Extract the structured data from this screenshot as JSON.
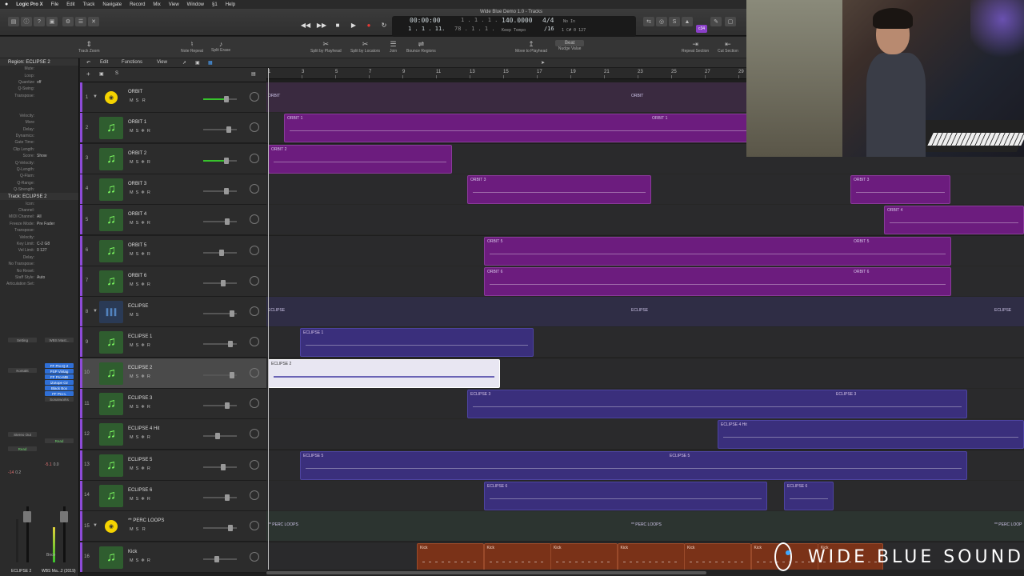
{
  "menubar": {
    "app": "Logic Pro X",
    "items": [
      "File",
      "Edit",
      "Track",
      "Navigate",
      "Record",
      "Mix",
      "View",
      "Window",
      "§1",
      "Help"
    ]
  },
  "window_title": "Wide Blue Demo 1.0 - Tracks",
  "lcd": {
    "time": "00:00:00",
    "bars": "1 . 1 . 1 .",
    "beat_sub": "1",
    "bars2": "1 . 1 . 1 .",
    "beat2": "78 . 1 . 1 .",
    "tempo": "140.0000",
    "tempo_label": "Keep Tempo",
    "sig": "4/4",
    "div": "/16",
    "in": "No In",
    "out": "1 C# 0 127",
    "cpu": "cpu"
  },
  "control_badge": "c34",
  "toolbar": {
    "tools": [
      "Track Zoom",
      "Note Repeat",
      "Split Erase",
      "Split by Playhead",
      "Split by Locators",
      "Join",
      "Bounce Regions",
      "Move to Playhead",
      "Nudge Value",
      "Repeat Section",
      "Cut Section"
    ],
    "nudge": "Beat"
  },
  "tracklist_bar": {
    "edit": "Edit",
    "functions": "Functions",
    "view": "View"
  },
  "ruler": [
    "1",
    "3",
    "5",
    "7",
    "9",
    "11",
    "13",
    "15",
    "17",
    "19",
    "21",
    "23",
    "25",
    "27",
    "29"
  ],
  "inspector": {
    "region_header": "Region: ECLIPSE 2",
    "region_params": [
      {
        "k": "Mute:",
        "v": ""
      },
      {
        "k": "Loop:",
        "v": ""
      },
      {
        "k": "Quantize",
        "v": "off"
      },
      {
        "k": "Q-Swing:",
        "v": ""
      },
      {
        "k": "Transpose:",
        "v": ""
      },
      {
        "k": "",
        "v": ""
      },
      {
        "k": "",
        "v": ""
      },
      {
        "k": "Velocity:",
        "v": ""
      },
      {
        "k": "More",
        "v": ""
      },
      {
        "k": "Delay:",
        "v": ""
      },
      {
        "k": "Dynamics:",
        "v": ""
      },
      {
        "k": "Gate Time:",
        "v": ""
      },
      {
        "k": "Clip Length:",
        "v": ""
      },
      {
        "k": "Score:",
        "v": "Show"
      },
      {
        "k": "Q-Velocity:",
        "v": ""
      },
      {
        "k": "Q-Length:",
        "v": ""
      },
      {
        "k": "Q-Flam:",
        "v": ""
      },
      {
        "k": "Q-Range:",
        "v": ""
      },
      {
        "k": "Q-Strength:",
        "v": ""
      }
    ],
    "track_header": "Track: ECLIPSE 2",
    "track_params": [
      {
        "k": "Icon:",
        "v": ""
      },
      {
        "k": "Channel:",
        "v": ""
      },
      {
        "k": "MIDI Channel:",
        "v": "All"
      },
      {
        "k": "Freeze Mode:",
        "v": "Pre Fader"
      },
      {
        "k": "Transpose:",
        "v": ""
      },
      {
        "k": "Velocity:",
        "v": ""
      },
      {
        "k": "Key Limit:",
        "v": "C-2 G8"
      },
      {
        "k": "Vel Limit:",
        "v": "0 127"
      },
      {
        "k": "Delay:",
        "v": ""
      },
      {
        "k": "No Transpose:",
        "v": ""
      },
      {
        "k": "No Reset:",
        "v": ""
      },
      {
        "k": "Staff Style:",
        "v": "Auto"
      },
      {
        "k": "Articulation Set:",
        "v": ""
      }
    ],
    "strip_left": {
      "setting": "Setting",
      "instrument": "Kontakt",
      "output": "Stereo Out",
      "read": "Read",
      "value": "-14",
      "peak": "0.2",
      "name": "ECLIPSE 2"
    },
    "strip_right": {
      "plugins": [
        "FF Pro-Q 2",
        "PSP Vintag",
        "FF Pro-MB",
        "iZotope Oz",
        "Black Box",
        "FF Pro-L",
        "Sonarworks"
      ],
      "setting": "WBS Mast...",
      "read": "Read",
      "value": "-5.1",
      "peak": "0.0",
      "output": "Bnce",
      "name": "WBS Ma...2 (2019)"
    }
  },
  "tracks": [
    {
      "num": "1",
      "name": "ORBIT",
      "type": "folder",
      "vol": 0.7,
      "fill": true
    },
    {
      "num": "2",
      "name": "ORBIT 1",
      "type": "midi",
      "vol": 0.75
    },
    {
      "num": "3",
      "name": "ORBIT 2",
      "type": "midi",
      "vol": 0.7,
      "fill": true
    },
    {
      "num": "4",
      "name": "ORBIT 3",
      "type": "midi",
      "vol": 0.7
    },
    {
      "num": "5",
      "name": "ORBIT 4",
      "type": "midi",
      "vol": 0.72
    },
    {
      "num": "6",
      "name": "ORBIT 5",
      "type": "midi",
      "vol": 0.55
    },
    {
      "num": "7",
      "name": "ORBIT 6",
      "type": "midi",
      "vol": 0.6
    },
    {
      "num": "8",
      "name": "ECLIPSE",
      "type": "audio",
      "vol": 0.85
    },
    {
      "num": "9",
      "name": "ECLIPSE 1",
      "type": "midi",
      "vol": 0.8
    },
    {
      "num": "10",
      "name": "ECLIPSE 2",
      "type": "midi",
      "vol": 0.85,
      "selected": true
    },
    {
      "num": "11",
      "name": "ECLIPSE 3",
      "type": "midi",
      "vol": 0.72
    },
    {
      "num": "12",
      "name": "ECLIPSE 4 Hit",
      "type": "midi",
      "vol": 0.42
    },
    {
      "num": "13",
      "name": "ECLIPSE 5",
      "type": "midi",
      "vol": 0.6
    },
    {
      "num": "14",
      "name": "ECLIPSE 6",
      "type": "midi",
      "vol": 0.72
    },
    {
      "num": "15",
      "name": "** PERC LOOPS",
      "type": "folder",
      "vol": 0.8
    },
    {
      "num": "16",
      "name": "Kick",
      "type": "midi",
      "vol": 0.4
    }
  ],
  "regions": {
    "orbit_folder": [
      "ORBIT",
      "ORBIT"
    ],
    "orbit1": [
      "ORBIT 1",
      "ORBIT 1"
    ],
    "orbit2": "ORBIT 2",
    "orbit3": [
      "ORBIT 3",
      "ORBIT 3"
    ],
    "orbit4": "ORBIT 4",
    "orbit5": [
      "ORBIT 5",
      "ORBIT 5"
    ],
    "orbit6": [
      "ORBIT 6",
      "ORBIT 6"
    ],
    "eclipse_folder": [
      "ECLIPSE",
      "ECLIPSE",
      "ECLIPSE"
    ],
    "eclipse1": "ECLIPSE 1",
    "eclipse2": "ECLIPSE 2",
    "eclipse3": [
      "ECLIPSE 3",
      "ECLIPSE 3"
    ],
    "eclipse4": "ECLIPSE 4 Hit",
    "eclipse5": [
      "ECLIPSE 5",
      "ECLIPSE 5"
    ],
    "eclipse6": [
      "ECLIPSE 6",
      "ECLIPSE 6"
    ],
    "perc_folder": [
      "** PERC LOOPS",
      "** PERC LOOPS",
      "** PERC LOOP"
    ],
    "kick": [
      "Kick",
      "Kick",
      "Kick",
      "Kick",
      "Kick",
      "Kick",
      "Kick"
    ]
  },
  "logo_text": "WIDE BLUE SOUND",
  "colors": {
    "orbit": "#6c1c7e",
    "eclipse": "#3a2f7c",
    "perc": "#7a3218",
    "selected_region": "#e8e6f2",
    "midi_icon": "#7eff62",
    "folder_icon": "#f5d300"
  }
}
